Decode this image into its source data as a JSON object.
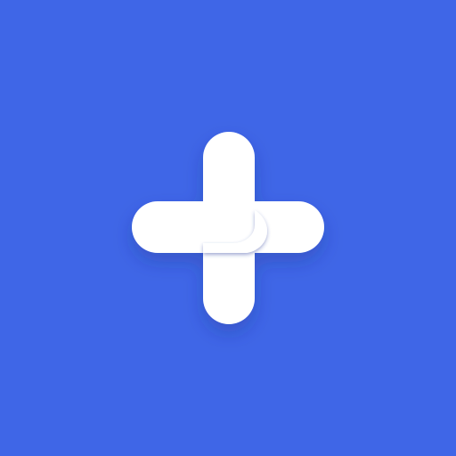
{
  "app_icon": {
    "icon": "plus-cross-logo-icon",
    "colors": {
      "background": "#3f66e7",
      "mark": "#ffffff",
      "mark_shadow": "#1f2f7a",
      "notch_shadow": "#2a3f9f"
    }
  }
}
